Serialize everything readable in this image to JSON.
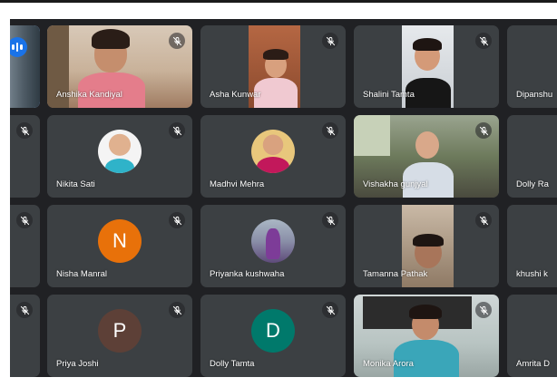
{
  "meeting": {
    "participants": [
      {
        "id": "p0",
        "name": "",
        "type": "video",
        "muted": false,
        "speaking": true
      },
      {
        "id": "p1",
        "name": "Anshika Kandiyal",
        "type": "video",
        "muted": true
      },
      {
        "id": "p2",
        "name": "Asha Kunwar",
        "type": "video",
        "muted": true
      },
      {
        "id": "p3",
        "name": "Shalini Tamta",
        "type": "video",
        "muted": true
      },
      {
        "id": "p4",
        "name": "Dipanshu",
        "type": "video",
        "muted": true
      },
      {
        "id": "p5",
        "name": "",
        "type": "blank",
        "muted": true
      },
      {
        "id": "p6",
        "name": "Nikita Sati",
        "type": "photo",
        "muted": true
      },
      {
        "id": "p7",
        "name": "Madhvi Mehra",
        "type": "photo",
        "muted": true
      },
      {
        "id": "p8",
        "name": "Vishakha gunjyal",
        "type": "video",
        "muted": true
      },
      {
        "id": "p9",
        "name": "Dolly Ra",
        "type": "blank",
        "muted": true
      },
      {
        "id": "p10",
        "name": "",
        "type": "blank",
        "muted": true
      },
      {
        "id": "p11",
        "name": "Nisha Manral",
        "type": "initial",
        "initial": "N",
        "color": "#e8710a",
        "muted": true
      },
      {
        "id": "p12",
        "name": "Priyanka kushwaha",
        "type": "photo",
        "muted": true
      },
      {
        "id": "p13",
        "name": "Tamanna Pathak",
        "type": "video",
        "muted": true
      },
      {
        "id": "p14",
        "name": "khushi k",
        "type": "blank",
        "muted": true
      },
      {
        "id": "p15",
        "name": "",
        "type": "blank",
        "muted": true
      },
      {
        "id": "p16",
        "name": "Priya Joshi",
        "type": "initial",
        "initial": "P",
        "color": "#5d4037",
        "muted": true
      },
      {
        "id": "p17",
        "name": "Dolly Tamta",
        "type": "initial",
        "initial": "D",
        "color": "#00796b",
        "muted": true
      },
      {
        "id": "p18",
        "name": "Monika Arora",
        "type": "video",
        "muted": true
      },
      {
        "id": "p19",
        "name": "Amrita D",
        "type": "blank",
        "muted": true
      }
    ]
  },
  "colors": {
    "background": "#202124",
    "tile": "#3c4043",
    "speaking_accent": "#1a73e8"
  }
}
